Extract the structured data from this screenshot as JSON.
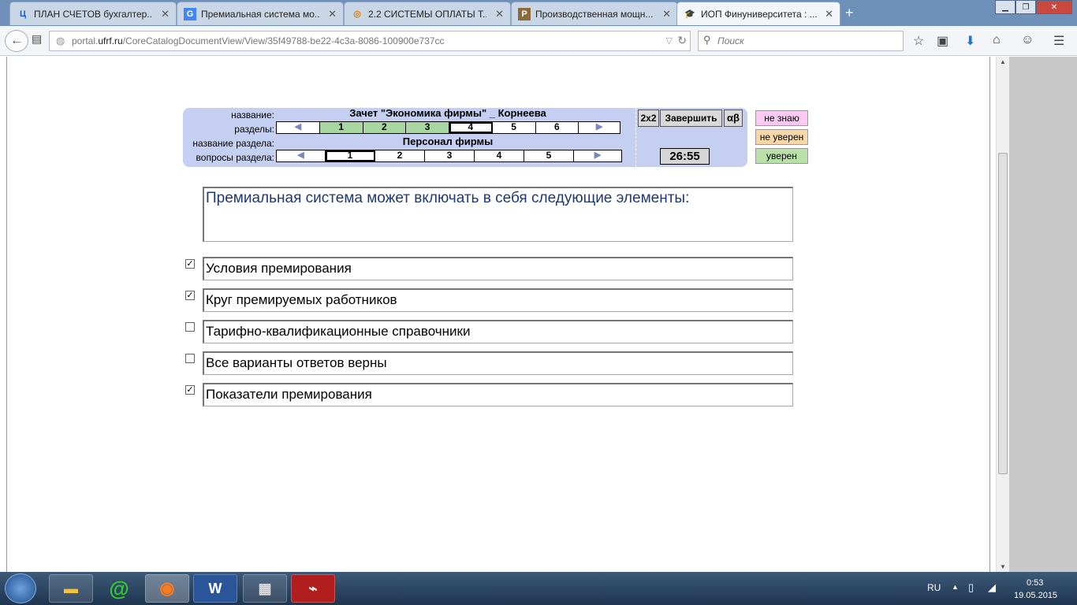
{
  "browser": {
    "tabs": [
      {
        "title": "ПЛАН СЧЕТОВ бухгалтер...",
        "icon": "Ц"
      },
      {
        "title": "Премиальная система мо...",
        "icon": "G"
      },
      {
        "title": "2.2 СИСТЕМЫ ОПЛАТЫ Т...",
        "icon": "◎"
      },
      {
        "title": "Производственная мощн...",
        "icon": "P"
      },
      {
        "title": "ИОП Финуниверситета : ...",
        "icon": "🎓"
      }
    ],
    "url_prefix": "portal.",
    "url_domain": "ufrf.ru",
    "url_path": "/CoreCatalogDocumentView/View/35f49788-be22-4c3a-8086-100900e737cc",
    "search_placeholder": "Поиск"
  },
  "panel": {
    "label_name": "название:",
    "label_sections": "разделы:",
    "label_section_name": "название раздела:",
    "label_questions": "вопросы раздела:",
    "test_name": "Зачет \"Экономика фирмы\" _ Корнеева",
    "section_name": "Персонал фирмы",
    "sections": [
      "1",
      "2",
      "3",
      "4",
      "5",
      "6"
    ],
    "questions": [
      "1",
      "2",
      "3",
      "4",
      "5"
    ],
    "btn_2x2": "2x2",
    "btn_finish": "Завершить",
    "btn_ab": "αβ",
    "timer": "26:55",
    "btn_dont_know": "не знаю",
    "btn_not_sure": "не уверен",
    "btn_sure": "уверен"
  },
  "question": {
    "text": "Премиальная система может включать в себя следующие элементы:",
    "answers": [
      {
        "text": "Условия премирования",
        "checked": true
      },
      {
        "text": "Круг премируемых работников",
        "checked": true
      },
      {
        "text": "Тарифно-квалификационные справочники",
        "checked": false
      },
      {
        "text": "Все варианты ответов верны",
        "checked": false
      },
      {
        "text": "Показатели премирования",
        "checked": true
      }
    ]
  },
  "taskbar": {
    "lang": "RU",
    "time": "0:53",
    "date": "19.05.2015"
  }
}
